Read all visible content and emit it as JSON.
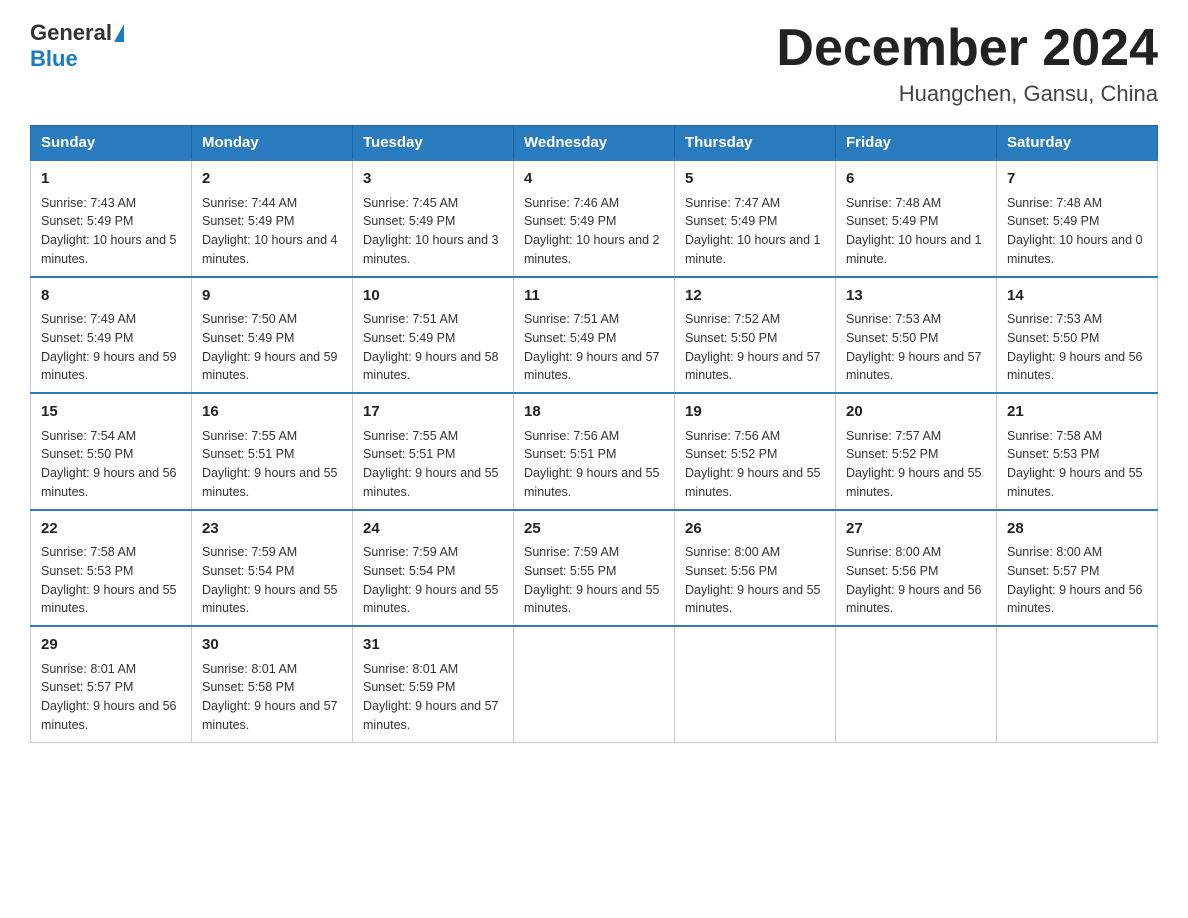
{
  "header": {
    "logo_text_general": "General",
    "logo_text_blue": "Blue",
    "month_title": "December 2024",
    "location": "Huangchen, Gansu, China"
  },
  "days_of_week": [
    "Sunday",
    "Monday",
    "Tuesday",
    "Wednesday",
    "Thursday",
    "Friday",
    "Saturday"
  ],
  "weeks": [
    [
      {
        "day": "1",
        "sunrise": "7:43 AM",
        "sunset": "5:49 PM",
        "daylight": "10 hours and 5 minutes."
      },
      {
        "day": "2",
        "sunrise": "7:44 AM",
        "sunset": "5:49 PM",
        "daylight": "10 hours and 4 minutes."
      },
      {
        "day": "3",
        "sunrise": "7:45 AM",
        "sunset": "5:49 PM",
        "daylight": "10 hours and 3 minutes."
      },
      {
        "day": "4",
        "sunrise": "7:46 AM",
        "sunset": "5:49 PM",
        "daylight": "10 hours and 2 minutes."
      },
      {
        "day": "5",
        "sunrise": "7:47 AM",
        "sunset": "5:49 PM",
        "daylight": "10 hours and 1 minute."
      },
      {
        "day": "6",
        "sunrise": "7:48 AM",
        "sunset": "5:49 PM",
        "daylight": "10 hours and 1 minute."
      },
      {
        "day": "7",
        "sunrise": "7:48 AM",
        "sunset": "5:49 PM",
        "daylight": "10 hours and 0 minutes."
      }
    ],
    [
      {
        "day": "8",
        "sunrise": "7:49 AM",
        "sunset": "5:49 PM",
        "daylight": "9 hours and 59 minutes."
      },
      {
        "day": "9",
        "sunrise": "7:50 AM",
        "sunset": "5:49 PM",
        "daylight": "9 hours and 59 minutes."
      },
      {
        "day": "10",
        "sunrise": "7:51 AM",
        "sunset": "5:49 PM",
        "daylight": "9 hours and 58 minutes."
      },
      {
        "day": "11",
        "sunrise": "7:51 AM",
        "sunset": "5:49 PM",
        "daylight": "9 hours and 57 minutes."
      },
      {
        "day": "12",
        "sunrise": "7:52 AM",
        "sunset": "5:50 PM",
        "daylight": "9 hours and 57 minutes."
      },
      {
        "day": "13",
        "sunrise": "7:53 AM",
        "sunset": "5:50 PM",
        "daylight": "9 hours and 57 minutes."
      },
      {
        "day": "14",
        "sunrise": "7:53 AM",
        "sunset": "5:50 PM",
        "daylight": "9 hours and 56 minutes."
      }
    ],
    [
      {
        "day": "15",
        "sunrise": "7:54 AM",
        "sunset": "5:50 PM",
        "daylight": "9 hours and 56 minutes."
      },
      {
        "day": "16",
        "sunrise": "7:55 AM",
        "sunset": "5:51 PM",
        "daylight": "9 hours and 55 minutes."
      },
      {
        "day": "17",
        "sunrise": "7:55 AM",
        "sunset": "5:51 PM",
        "daylight": "9 hours and 55 minutes."
      },
      {
        "day": "18",
        "sunrise": "7:56 AM",
        "sunset": "5:51 PM",
        "daylight": "9 hours and 55 minutes."
      },
      {
        "day": "19",
        "sunrise": "7:56 AM",
        "sunset": "5:52 PM",
        "daylight": "9 hours and 55 minutes."
      },
      {
        "day": "20",
        "sunrise": "7:57 AM",
        "sunset": "5:52 PM",
        "daylight": "9 hours and 55 minutes."
      },
      {
        "day": "21",
        "sunrise": "7:58 AM",
        "sunset": "5:53 PM",
        "daylight": "9 hours and 55 minutes."
      }
    ],
    [
      {
        "day": "22",
        "sunrise": "7:58 AM",
        "sunset": "5:53 PM",
        "daylight": "9 hours and 55 minutes."
      },
      {
        "day": "23",
        "sunrise": "7:59 AM",
        "sunset": "5:54 PM",
        "daylight": "9 hours and 55 minutes."
      },
      {
        "day": "24",
        "sunrise": "7:59 AM",
        "sunset": "5:54 PM",
        "daylight": "9 hours and 55 minutes."
      },
      {
        "day": "25",
        "sunrise": "7:59 AM",
        "sunset": "5:55 PM",
        "daylight": "9 hours and 55 minutes."
      },
      {
        "day": "26",
        "sunrise": "8:00 AM",
        "sunset": "5:56 PM",
        "daylight": "9 hours and 55 minutes."
      },
      {
        "day": "27",
        "sunrise": "8:00 AM",
        "sunset": "5:56 PM",
        "daylight": "9 hours and 56 minutes."
      },
      {
        "day": "28",
        "sunrise": "8:00 AM",
        "sunset": "5:57 PM",
        "daylight": "9 hours and 56 minutes."
      }
    ],
    [
      {
        "day": "29",
        "sunrise": "8:01 AM",
        "sunset": "5:57 PM",
        "daylight": "9 hours and 56 minutes."
      },
      {
        "day": "30",
        "sunrise": "8:01 AM",
        "sunset": "5:58 PM",
        "daylight": "9 hours and 57 minutes."
      },
      {
        "day": "31",
        "sunrise": "8:01 AM",
        "sunset": "5:59 PM",
        "daylight": "9 hours and 57 minutes."
      },
      null,
      null,
      null,
      null
    ]
  ],
  "labels": {
    "sunrise": "Sunrise:",
    "sunset": "Sunset:",
    "daylight": "Daylight:"
  }
}
